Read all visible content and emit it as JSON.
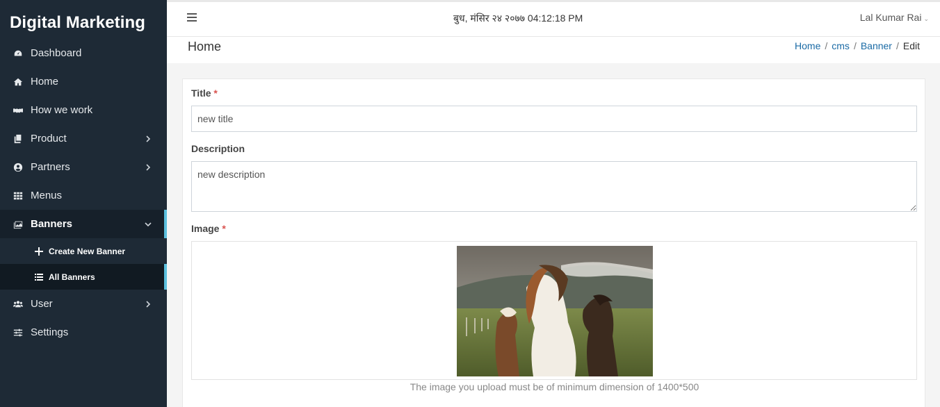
{
  "brand": "Digital Marketing",
  "sidebar": {
    "items": [
      {
        "label": "Dashboard",
        "icon": "dashboard-icon"
      },
      {
        "label": "Home",
        "icon": "home-icon"
      },
      {
        "label": "How we work",
        "icon": "handshake-icon"
      },
      {
        "label": "Product",
        "icon": "copy-icon"
      },
      {
        "label": "Partners",
        "icon": "user-circle-icon"
      },
      {
        "label": "Menus",
        "icon": "grid-icon"
      },
      {
        "label": "Banners",
        "icon": "images-icon"
      },
      {
        "label": "User",
        "icon": "users-icon"
      },
      {
        "label": "Settings",
        "icon": "sliders-icon"
      }
    ],
    "banners_sub": [
      {
        "label": "Create New Banner",
        "icon": "plus-icon"
      },
      {
        "label": "All Banners",
        "icon": "list-icon"
      }
    ]
  },
  "topbar": {
    "datetime": "बुध, मंसिर २४ २०७७  04:12:18 PM",
    "user_name": "Lal Kumar Rai",
    "user_caret": "⌄"
  },
  "header": {
    "title": "Home",
    "breadcrumb": [
      "Home",
      "cms",
      "Banner",
      "Edit"
    ],
    "breadcrumb_sep": "/"
  },
  "form": {
    "title_label": "Title",
    "title_value": "new title",
    "required_mark": "*",
    "description_label": "Description",
    "description_value": "new description",
    "image_label": "Image",
    "image_hint": "The image you upload must be of minimum dimension of 1400*500"
  },
  "colors": {
    "sidebar_bg": "#1e2a36",
    "active_accent": "#5bc0de",
    "link": "#1a6aa5",
    "required": "#d9534f"
  }
}
